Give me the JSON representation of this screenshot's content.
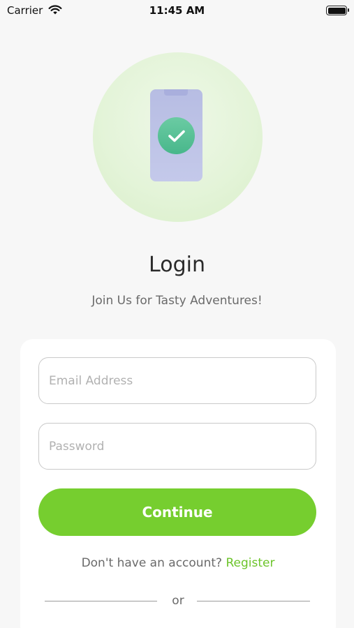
{
  "status_bar": {
    "carrier": "Carrier",
    "time": "11:45 AM"
  },
  "hero": {
    "illustration": "phone-with-checkmark"
  },
  "login": {
    "title": "Login",
    "subtitle": "Join Us for Tasty Adventures!"
  },
  "form": {
    "email_placeholder": "Email Address",
    "email_value": "",
    "password_placeholder": "Password",
    "password_value": "",
    "continue_label": "Continue",
    "no_account_text": "Don't have an account?",
    "register_label": "Register",
    "or_label": "or"
  },
  "colors": {
    "accent_green": "#76ce2f",
    "link_green": "#6cc42a",
    "check_badge": "#4fbc90",
    "phone_body": "#bfc4e7"
  }
}
